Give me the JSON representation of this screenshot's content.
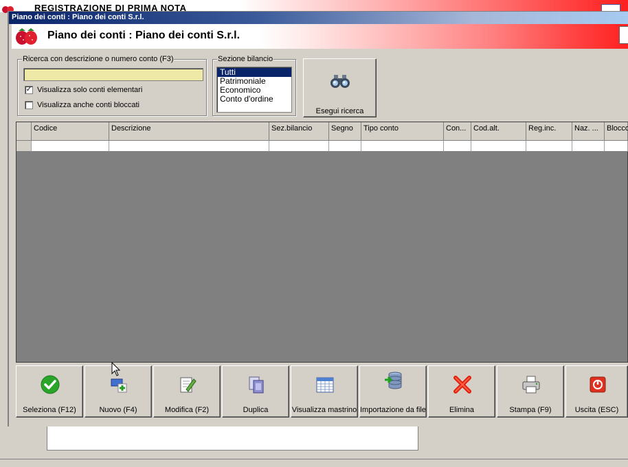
{
  "background_window": {
    "title": "REGISTRAZIONE DI PRIMA NOTA"
  },
  "window": {
    "title": "Piano dei conti : Piano dei conti S.r.l.",
    "header_title": "Piano dei conti : Piano dei conti S.r.l."
  },
  "search": {
    "group_label": "Ricerca con descrizione o numero conto (F3)",
    "input_value": "",
    "checkbox_elementari_label": "Visualizza solo conti elementari",
    "checkbox_elementari_checked": true,
    "checkbox_bloccati_label": "Visualizza anche conti bloccati",
    "checkbox_bloccati_checked": false
  },
  "sezione": {
    "group_label": "Sezione bilancio",
    "options": [
      "Tutti",
      "Patrimoniale",
      "Economico",
      "Conto d'ordine"
    ],
    "selected": "Tutti"
  },
  "search_button": {
    "label": "Esegui ricerca",
    "icon": "binoculars-icon"
  },
  "grid": {
    "columns": [
      "Codice",
      "Descrizione",
      "Sez.bilancio",
      "Segno",
      "Tipo conto",
      "Con...",
      "Cod.alt.",
      "Reg.inc.",
      "Naz. ...",
      "Blocco"
    ],
    "rows": []
  },
  "toolbar": {
    "buttons": [
      {
        "label": "Seleziona (F12)",
        "icon": "checkmark-icon"
      },
      {
        "label": "Nuovo (F4)",
        "icon": "new-record-icon"
      },
      {
        "label": "Modifica (F2)",
        "icon": "edit-icon"
      },
      {
        "label": "Duplica",
        "icon": "duplicate-icon"
      },
      {
        "label": "Visualizza mastrino",
        "icon": "calendar-icon"
      },
      {
        "label": "Importazione da file",
        "icon": "import-database-icon"
      },
      {
        "label": "Elimina",
        "icon": "delete-icon"
      },
      {
        "label": "Stampa (F9)",
        "icon": "printer-icon"
      },
      {
        "label": "Uscita (ESC)",
        "icon": "exit-icon"
      }
    ]
  },
  "colors": {
    "titlebar_start": "#0a246a",
    "titlebar_end": "#a6caf0",
    "search_field_bg": "#eee9a6",
    "grid_empty_bg": "#808080",
    "header_accent": "#ff2020"
  }
}
